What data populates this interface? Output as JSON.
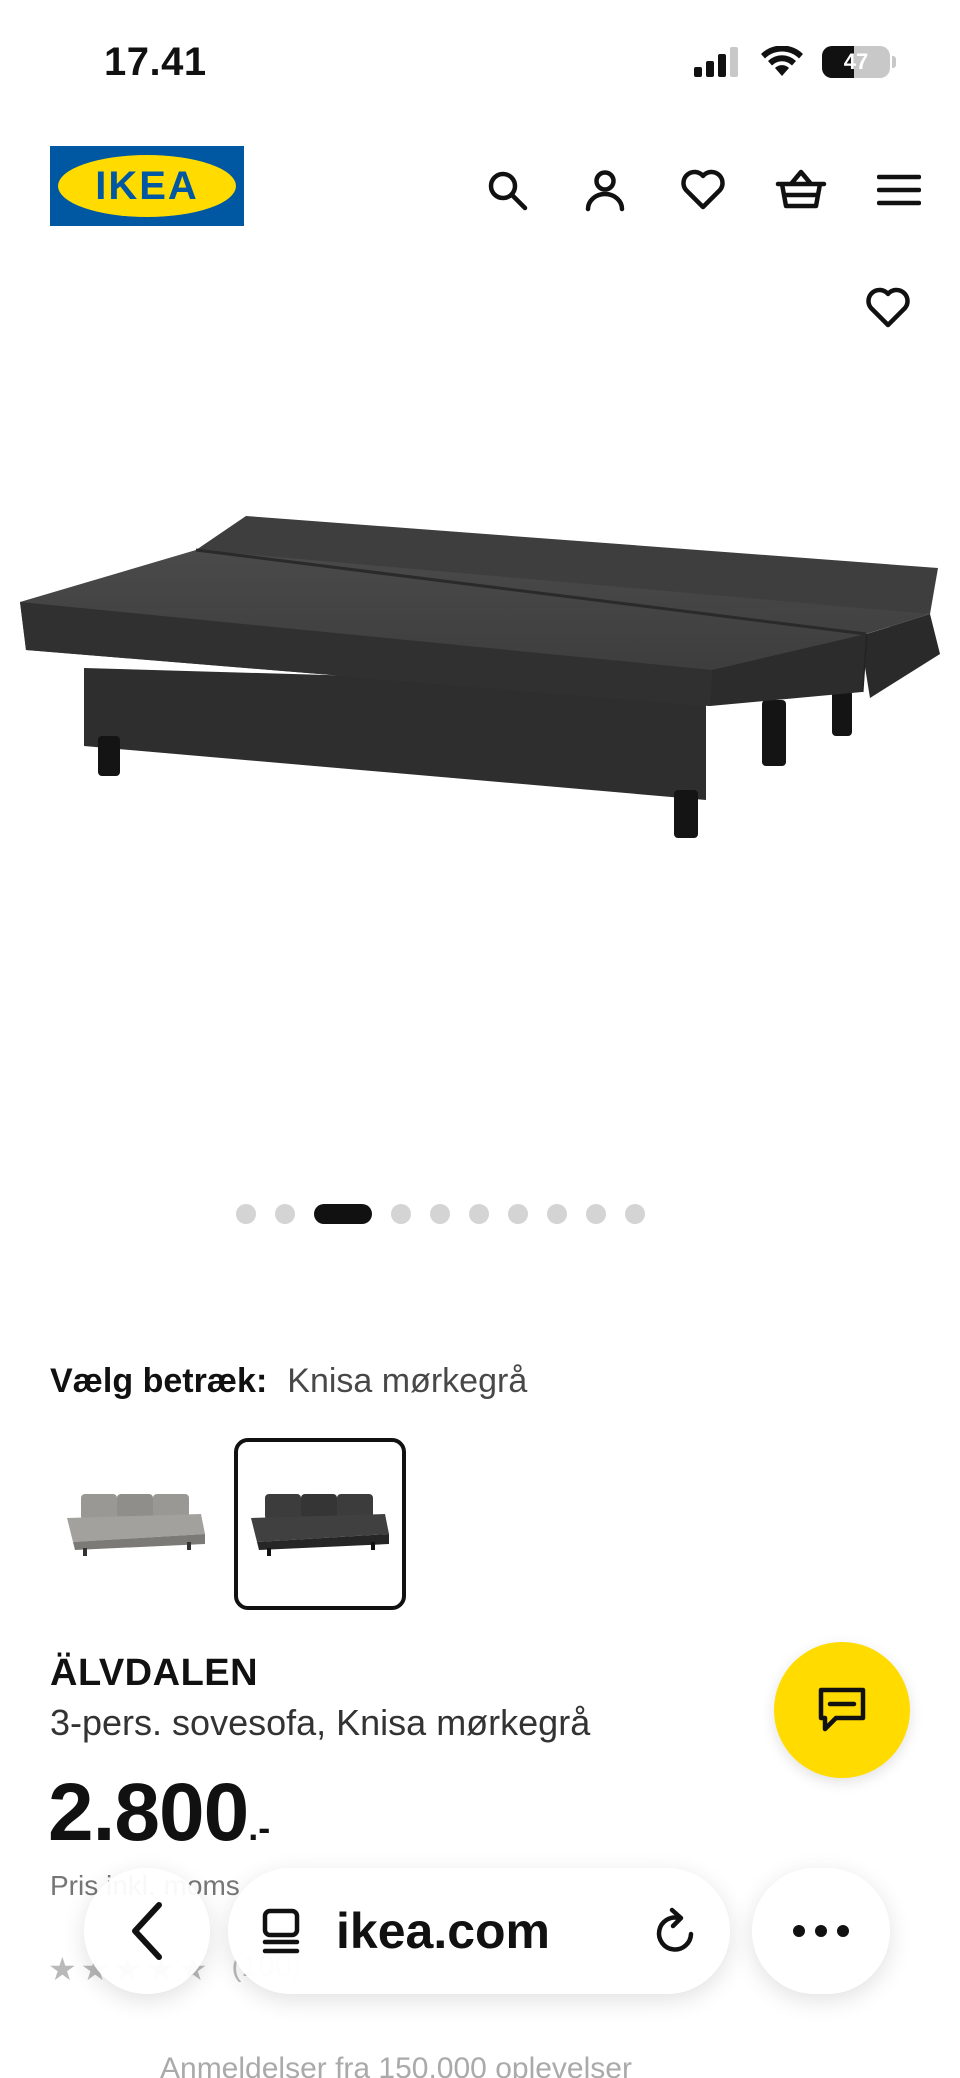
{
  "status": {
    "time": "17.41",
    "battery": "47",
    "battery_level": 0.47
  },
  "header": {
    "logo_text": "IKEA",
    "icons": [
      "search-icon",
      "account-icon",
      "wishlist-icon",
      "basket-icon",
      "menu-icon"
    ]
  },
  "gallery": {
    "dot_count": 10,
    "active_index": 2
  },
  "cover": {
    "label": "Vælg betræk:",
    "value": "Knisa mørkegrå",
    "options": [
      "light-grey-sofa",
      "dark-grey-sofa"
    ],
    "selected_index": 1
  },
  "product": {
    "name": "ÄLVDALEN",
    "description": "3-pers. sovesofa, Knisa mørkegrå",
    "price_integer": "2.800",
    "price_suffix": ".-",
    "price_note": "Pris inkl. moms",
    "rating_count": "(100)"
  },
  "footer_hint": "Anmeldelser fra 150.000 oplevelser",
  "browser": {
    "url": "ikea.com"
  },
  "colors": {
    "brand_blue": "#0058a3",
    "brand_yellow": "#ffdb00",
    "text": "#111111"
  }
}
